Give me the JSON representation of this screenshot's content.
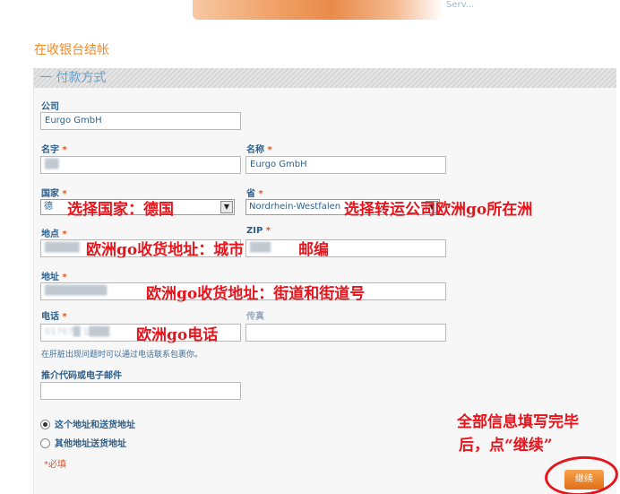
{
  "page": {
    "title": "在收银台结帐",
    "banner_right_text": "Serv..."
  },
  "payment_section": {
    "header": "一 付款方式"
  },
  "form": {
    "company": {
      "label": "公司",
      "value": "Eurgo GmbH"
    },
    "first_name": {
      "label": "名字",
      "required_mark": "*",
      "value": "██"
    },
    "name": {
      "label": "名称",
      "required_mark": "*",
      "value": "Eurgo GmbH"
    },
    "country": {
      "label": "国家",
      "required_mark": "*",
      "value": "德"
    },
    "state": {
      "label": "省",
      "required_mark": "*",
      "value": "Nordrhein-Westfalen"
    },
    "city": {
      "label": "地点",
      "required_mark": "*",
      "value": "█████"
    },
    "zip": {
      "label": "ZIP",
      "required_mark": "*",
      "value": "███"
    },
    "address": {
      "label": "地址",
      "required_mark": "*",
      "value": "█████████"
    },
    "phone": {
      "label": "电话",
      "required_mark": "*",
      "value": "01767█ 1███"
    },
    "fax": {
      "label": "传真",
      "value": ""
    },
    "phone_hint": "在肝脏出现问题时可以通过电话联系包裹你。",
    "referral": {
      "label": "推介代码或电子邮件",
      "value": ""
    },
    "shipping_options": [
      {
        "label": "这个地址和送货地址",
        "checked": true
      },
      {
        "label": "其他地址送货地址",
        "checked": false
      }
    ],
    "required_note": "*必填",
    "continue_label": "继续"
  },
  "annotations": {
    "country": "选择国家：德国",
    "state": "选择转运公司欧洲go所在洲",
    "city": "欧洲go收货地址：城市",
    "zip": "邮编",
    "address": "欧洲go收货地址：街道和街道号",
    "phone": "欧洲go电话",
    "done_line1": "全部信息填写完毕",
    "done_line2": "后，点“继续”"
  },
  "colors": {
    "accent_orange": "#f08a24",
    "label_blue": "#2d5f8a",
    "annotation_red": "#e8141c"
  }
}
